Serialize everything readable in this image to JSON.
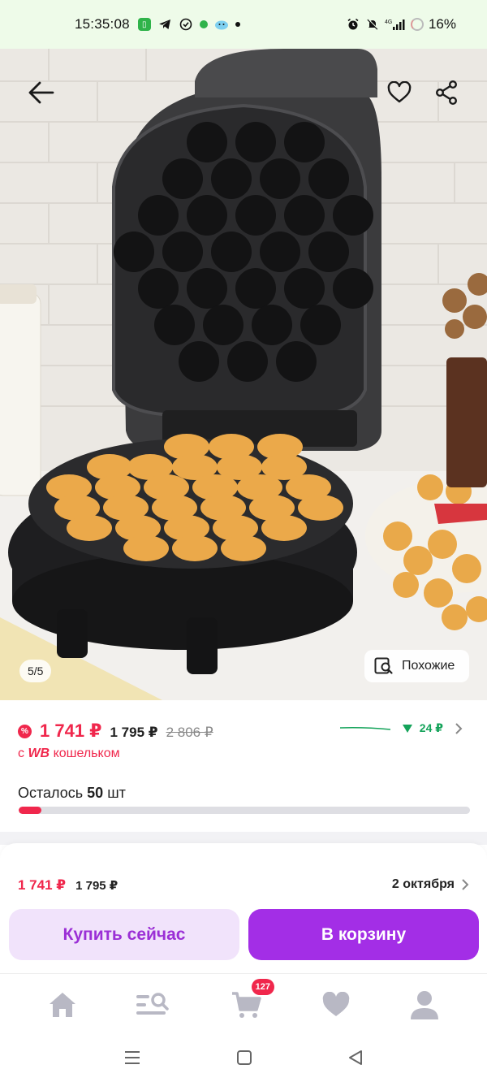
{
  "status_bar": {
    "time": "15:35:08",
    "battery": "16%",
    "network": "4G"
  },
  "gallery": {
    "counter": "5/5",
    "similar_label": "Похожие"
  },
  "price": {
    "current": "1 741 ₽",
    "secondary": "1 795 ₽",
    "old": "2 806 ₽",
    "trend_value": "24 ₽",
    "wallet_prefix": "с",
    "wallet_brand": "WB",
    "wallet_suffix": "кошельком"
  },
  "stock": {
    "prefix": "Осталось",
    "count": "50",
    "unit": "шт",
    "level_percent": 5
  },
  "buy_bar": {
    "price": "1 741 ₽",
    "price_secondary": "1 795 ₽",
    "delivery_date": "2 октября",
    "buy_now_label": "Купить сейчас",
    "add_to_cart_label": "В корзину"
  },
  "tab_bar": {
    "cart_count": "127",
    "items": [
      "home-icon",
      "catalog-search-icon",
      "cart-icon",
      "heart-icon",
      "profile-icon"
    ]
  },
  "colors": {
    "accent_red": "#f0274c",
    "brand_purple": "#a32ee6",
    "light_purple": "#f1e3fb",
    "trend_green": "#14a35a",
    "status_bar_bg": "#eefbe9"
  }
}
